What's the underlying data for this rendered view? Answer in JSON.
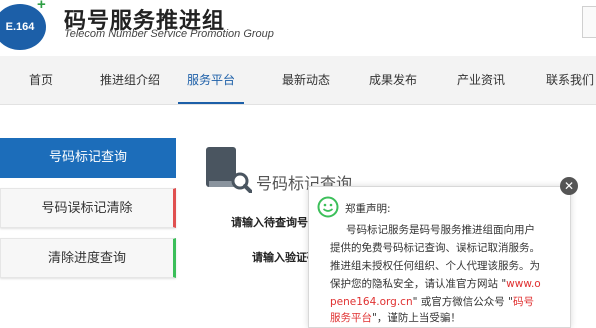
{
  "header": {
    "logo_text": "E.164",
    "title": "码号服务推进组",
    "subtitle": "Telecom Number Service  Promotion Group"
  },
  "nav": {
    "items": [
      {
        "label": "首页"
      },
      {
        "label": "推进组介绍"
      },
      {
        "label": "服务平台",
        "active": true
      },
      {
        "label": "最新动态"
      },
      {
        "label": "成果发布"
      },
      {
        "label": "产业资讯"
      },
      {
        "label": "联系我们"
      }
    ]
  },
  "sidebar": {
    "items": [
      {
        "label": "号码标记查询",
        "active": true
      },
      {
        "label": "号码误标记清除"
      },
      {
        "label": "清除进度查询"
      }
    ]
  },
  "main": {
    "title": "号码标记查询",
    "query_label": "请输入待查询号码",
    "code_label": "请输入验证码"
  },
  "popup": {
    "title": "郑重声明:",
    "line1": "号码标记服务是码号服务推进组面向用户",
    "line2": "提供的免费号码标记查询、误标记取消服务。",
    "line3": "推进组未授权任何组织、个人代理该服务。为",
    "line4_a": "保护您的隐私安全，请认准官方网站 \"",
    "line4_b": "www.o",
    "line5_a": "pene164.org.cn",
    "line5_b": "\" 或官方微信公众号 \"",
    "line5_c": "码号",
    "line6_a": "服务平台",
    "line6_b": "\"，谨防上当受骗！"
  },
  "colors": {
    "brand_blue": "#1c6dba",
    "accent_red": "#e03030",
    "accent_green": "#3cbf5a"
  }
}
